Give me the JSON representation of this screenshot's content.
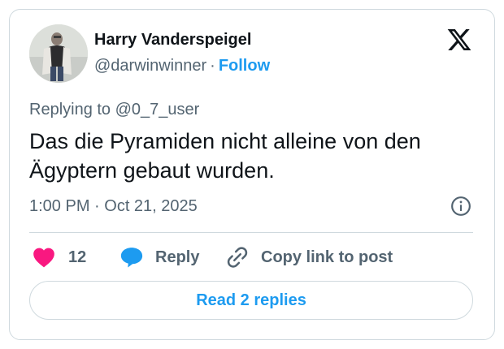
{
  "author": {
    "name": "Harry Vanderspeigel",
    "handle": "@darwinwinner",
    "separator": "·",
    "follow_label": "Follow",
    "avatar_icon": "user-avatar-photo"
  },
  "logo_icon": "x-logo-icon",
  "tweet": {
    "replying_to": "Replying to @0_7_user",
    "text": "Das die Pyramiden nicht alleine von den Ägyptern gebaut wurden.",
    "timestamp": "1:00 PM · Oct 21, 2025"
  },
  "actions": {
    "like_count": "12",
    "reply_label": "Reply",
    "copy_label": "Copy link to post"
  },
  "read_replies_label": "Read 2 replies",
  "colors": {
    "accent": "#1d9bf0",
    "like": "#f91880",
    "text": "#0f1419",
    "secondary": "#536471",
    "border": "#cfd9de"
  }
}
